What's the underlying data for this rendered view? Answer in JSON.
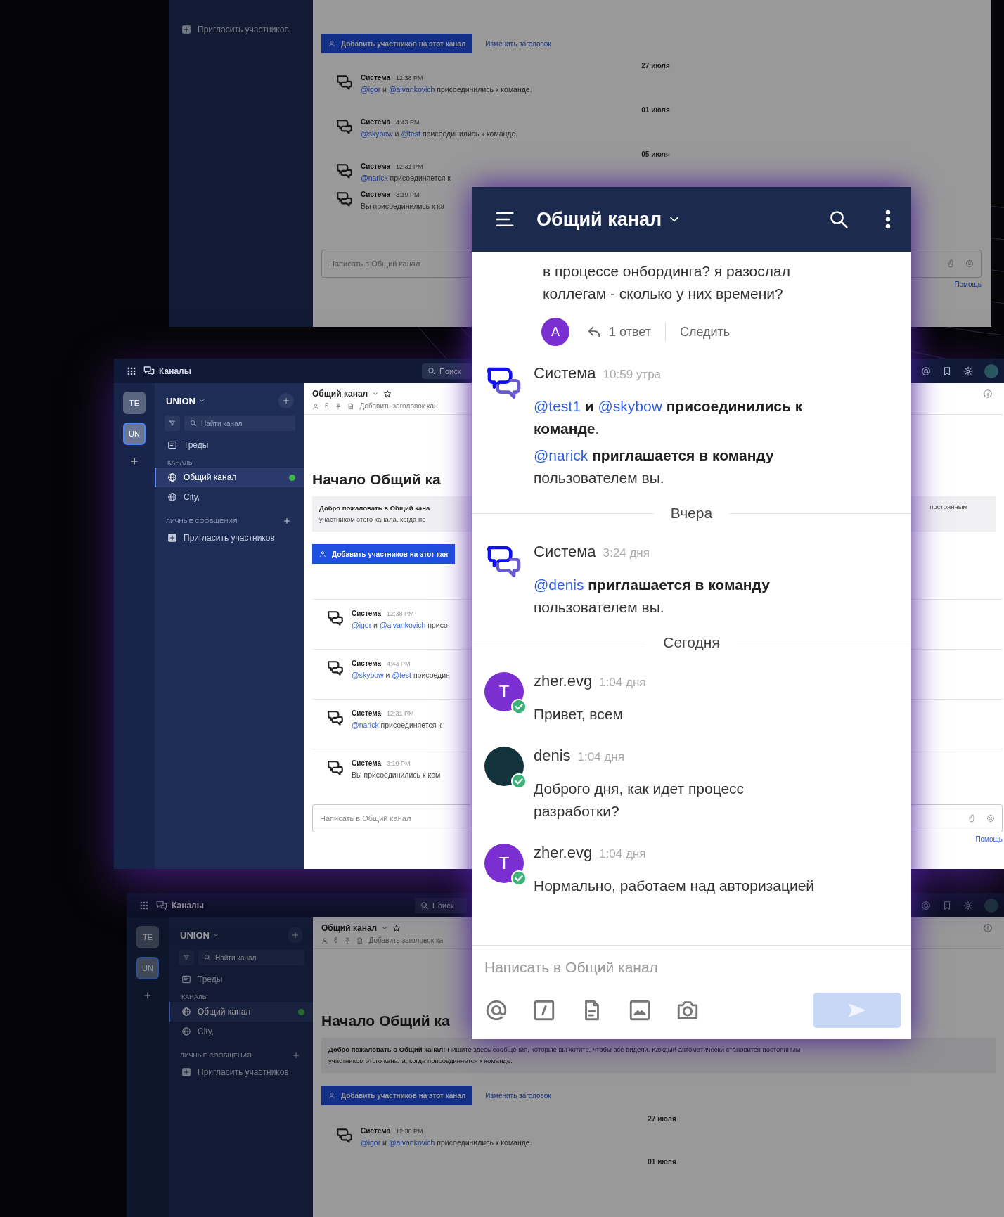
{
  "top_window": {
    "sidebar": {
      "items": [
        {
          "kind": "invite",
          "label": "Пригласить участников",
          "selected": false
        }
      ]
    },
    "main": [
      {
        "kind": "actions",
        "button": "Добавить участников на этот канал",
        "link": "Изменить заголовок"
      },
      {
        "kind": "date",
        "text": "27 июля"
      },
      {
        "kind": "post",
        "author": "Система",
        "time": "12:38 PM",
        "segments": [
          {
            "kind": "mention",
            "text": "@igor"
          },
          {
            "kind": "plain",
            "text": " и "
          },
          {
            "kind": "mention",
            "text": "@aivankovich"
          },
          {
            "kind": "plain",
            "text": " присоединились к команде."
          }
        ]
      },
      {
        "kind": "date",
        "text": "01 июля"
      },
      {
        "kind": "post",
        "author": "Система",
        "time": "4:43 PM",
        "segments": [
          {
            "kind": "mention",
            "text": "@skybow"
          },
          {
            "kind": "plain",
            "text": " и "
          },
          {
            "kind": "mention",
            "text": "@test"
          },
          {
            "kind": "plain",
            "text": " присоединились к команде."
          }
        ]
      },
      {
        "kind": "date",
        "text": "05 июля"
      },
      {
        "kind": "post",
        "author": "Система",
        "time": "12:31 PM",
        "segments": [
          {
            "kind": "mention",
            "text": "@narick"
          },
          {
            "kind": "plain",
            "text": " присоединяется к"
          }
        ]
      },
      {
        "kind": "post",
        "author": "Система",
        "time": "3:19 PM",
        "segments": [
          {
            "kind": "plain",
            "text": "Вы присоединились к ка"
          }
        ]
      },
      {
        "kind": "composer",
        "placeholder": "Написать в Общий канал",
        "help": "Помощь"
      }
    ]
  },
  "main_window": {
    "topbar": {
      "app_title": "Каналы",
      "search_placeholder": "Поиск"
    },
    "rail": [
      {
        "label": "ТЕ",
        "selected": false
      },
      {
        "label": "UN",
        "selected": true
      }
    ],
    "sidebar": {
      "team": "UNION",
      "search_placeholder": "Найти канал",
      "items": [
        {
          "kind": "threads",
          "label": "Треды",
          "selected": false
        },
        {
          "kind": "section",
          "label": "КАНАЛЫ",
          "selected": false
        },
        {
          "kind": "channel",
          "label": "Общий канал",
          "selected": true,
          "unread": true
        },
        {
          "kind": "channel",
          "label": "City,",
          "selected": false,
          "unread": false
        },
        {
          "kind": "dm_section",
          "label": "ЛИЧНЫЕ СООБЩЕНИЯ",
          "selected": false
        },
        {
          "kind": "invite",
          "label": "Пригласить участников",
          "selected": false
        }
      ]
    },
    "main": [
      {
        "kind": "header",
        "title": "Общий канал",
        "members": "6",
        "topic": "Добавить заголовок кан"
      },
      {
        "kind": "intro",
        "text": "Начало Общий ка"
      },
      {
        "kind": "welcome",
        "lines": [
          [
            {
              "kind": "bold",
              "text": "Добро пожаловать в Общий кана"
            }
          ],
          [
            {
              "kind": "plain",
              "text": "участником этого канала, когда пр"
            }
          ]
        ],
        "right_text": "постоянным"
      },
      {
        "kind": "actions",
        "button": "Добавить участников на этот кан"
      },
      {
        "kind": "post",
        "author": "Система",
        "time": "12:38 PM",
        "segments": [
          {
            "kind": "mention",
            "text": "@igor"
          },
          {
            "kind": "plain",
            "text": " и "
          },
          {
            "kind": "mention",
            "text": "@aivankovich"
          },
          {
            "kind": "plain",
            "text": " присо"
          }
        ]
      },
      {
        "kind": "post",
        "author": "Система",
        "time": "4:43 PM",
        "segments": [
          {
            "kind": "mention",
            "text": "@skybow"
          },
          {
            "kind": "plain",
            "text": " и "
          },
          {
            "kind": "mention",
            "text": "@test"
          },
          {
            "kind": "plain",
            "text": " присоедин"
          }
        ]
      },
      {
        "kind": "post",
        "author": "Система",
        "time": "12:31 PM",
        "segments": [
          {
            "kind": "mention",
            "text": "@narick"
          },
          {
            "kind": "plain",
            "text": " присоединяется к"
          }
        ]
      },
      {
        "kind": "post",
        "author": "Система",
        "time": "3:19 PM",
        "segments": [
          {
            "kind": "plain",
            "text": "Вы присоединились к ком"
          }
        ]
      },
      {
        "kind": "composer",
        "placeholder": "Написать в Общий канал",
        "help": "Помощь"
      }
    ]
  },
  "bottom_window": {
    "topbar": {
      "app_title": "Каналы",
      "search_placeholder": "Поиск"
    },
    "rail": [
      {
        "label": "ТЕ",
        "selected": false
      },
      {
        "label": "UN",
        "selected": true
      }
    ],
    "sidebar": {
      "team": "UNION",
      "search_placeholder": "Найти канал",
      "items": [
        {
          "kind": "threads",
          "label": "Треды",
          "selected": false
        },
        {
          "kind": "section",
          "label": "КАНАЛЫ",
          "selected": false
        },
        {
          "kind": "channel",
          "label": "Общий канал",
          "selected": true,
          "unread": true
        },
        {
          "kind": "channel",
          "label": "City,",
          "selected": false,
          "unread": false
        },
        {
          "kind": "dm_section",
          "label": "ЛИЧНЫЕ СООБЩЕНИЯ",
          "selected": false
        },
        {
          "kind": "invite",
          "label": "Пригласить участников",
          "selected": false
        }
      ]
    },
    "main": [
      {
        "kind": "header",
        "title": "Общий канал",
        "members": "6",
        "topic": "Добавить заголовок ка"
      },
      {
        "kind": "intro",
        "text": "Начало Общий ка"
      },
      {
        "kind": "welcome",
        "lines": [
          [
            {
              "kind": "bold",
              "text": "Добро пожаловать в Общий канал!"
            },
            {
              "kind": "plain",
              "text": " Пишите здесь сообщения, которые вы хотите, чтобы все видели. Каждый автоматически становится постоянным"
            }
          ],
          [
            {
              "kind": "plain",
              "text": "участником этого канала, когда присоединяется к команде."
            }
          ]
        ]
      },
      {
        "kind": "actions",
        "button": "Добавить участников на этот канал",
        "link": "Изменить заголовок"
      },
      {
        "kind": "date",
        "text": "27 июля"
      },
      {
        "kind": "post",
        "author": "Система",
        "time": "12:38 PM",
        "segments": [
          {
            "kind": "mention",
            "text": "@igor"
          },
          {
            "kind": "plain",
            "text": " и "
          },
          {
            "kind": "mention",
            "text": "@aivankovich"
          },
          {
            "kind": "plain",
            "text": " присоединились к команде."
          }
        ]
      },
      {
        "kind": "date",
        "text": "01 июля"
      }
    ]
  },
  "mobile": {
    "title": "Общий канал",
    "feed": [
      {
        "kind": "continuation",
        "text": "в процессе онбординга? я разослал коллегам - сколько у них времени?",
        "thread": {
          "avatar_letter": "A",
          "replies": "1 ответ",
          "follow": "Следить"
        }
      },
      {
        "kind": "post",
        "avatar": {
          "kind": "system"
        },
        "author": "Система",
        "time": "10:59 утра",
        "online": false,
        "paragraphs": [
          [
            {
              "kind": "mention",
              "text": "@test1"
            },
            {
              "kind": "bold",
              "text": " и "
            },
            {
              "kind": "mention",
              "text": "@skybow"
            },
            {
              "kind": "bold",
              "text": " присоединились к команде"
            },
            {
              "kind": "plain",
              "text": "."
            }
          ],
          [
            {
              "kind": "mention",
              "text": "@narick"
            },
            {
              "kind": "bold",
              "text": " приглашается в команду"
            },
            {
              "kind": "plain",
              "text": " пользователем вы."
            }
          ]
        ]
      },
      {
        "kind": "date",
        "text": "Вчера"
      },
      {
        "kind": "post",
        "avatar": {
          "kind": "system"
        },
        "author": "Система",
        "time": "3:24 дня",
        "online": false,
        "paragraphs": [
          [
            {
              "kind": "mention",
              "text": "@denis"
            },
            {
              "kind": "bold",
              "text": " приглашается в команду"
            },
            {
              "kind": "plain",
              "text": " пользователем вы."
            }
          ]
        ]
      },
      {
        "kind": "date",
        "text": "Сегодня"
      },
      {
        "kind": "post",
        "avatar": {
          "kind": "letter",
          "letter": "T"
        },
        "author": "zher.evg",
        "time": "1:04 дня",
        "online": true,
        "paragraphs": [
          [
            {
              "kind": "plain",
              "text": "Привет, всем"
            }
          ]
        ]
      },
      {
        "kind": "post",
        "avatar": {
          "kind": "photo"
        },
        "author": "denis",
        "time": "1:04 дня",
        "online": true,
        "paragraphs": [
          [
            {
              "kind": "plain",
              "text": "Доброго дня, как идет процесс разработки?"
            }
          ]
        ]
      },
      {
        "kind": "post",
        "avatar": {
          "kind": "letter",
          "letter": "T"
        },
        "author": "zher.evg",
        "time": "1:04 дня",
        "online": true,
        "paragraphs": [
          [
            {
              "kind": "plain",
              "text": "Нормально, работаем над авторизацией"
            }
          ]
        ]
      }
    ],
    "composer": {
      "placeholder": "Написать в Общий канал",
      "send_enabled": false
    }
  }
}
